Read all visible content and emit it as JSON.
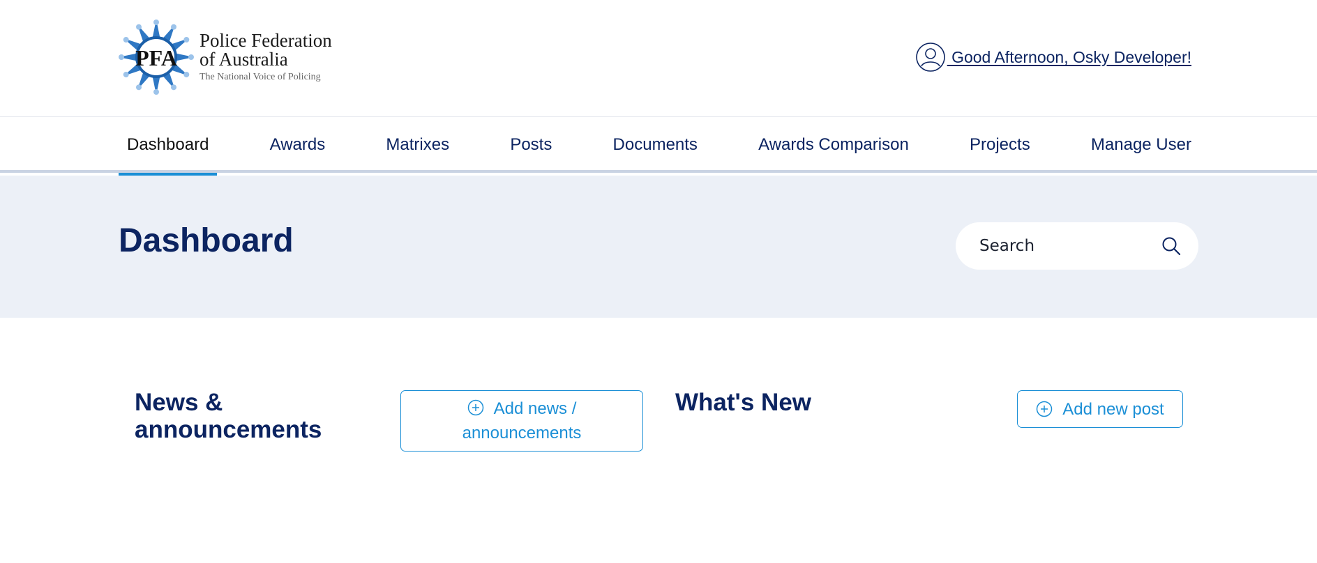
{
  "brand": {
    "name_line1": "Police Federation",
    "name_line2": "of Australia",
    "tagline": "The National Voice of Policing",
    "emblem_letters": "PFA",
    "logo_icon": "pfa-star-emblem",
    "brand_color": "#1b5fa8"
  },
  "user": {
    "icon": "user-circle-icon",
    "greeting": " Good Afternoon, Osky Developer!"
  },
  "nav": {
    "active": "Dashboard",
    "items": [
      {
        "label": "Dashboard"
      },
      {
        "label": "Awards"
      },
      {
        "label": "Matrixes"
      },
      {
        "label": "Posts"
      },
      {
        "label": "Documents"
      },
      {
        "label": "Awards Comparison"
      },
      {
        "label": "Projects"
      },
      {
        "label": "Manage User"
      }
    ]
  },
  "banner": {
    "title": "Dashboard",
    "search_placeholder": "Search",
    "search_icon": "search-icon"
  },
  "news": {
    "title_line1": "News &",
    "title_line2": "announcements",
    "button_label": "Add news / announcements",
    "button_icon": "plus-circle-icon"
  },
  "whats_new": {
    "title": "What's New",
    "button_label": "Add new post",
    "button_icon": "plus-circle-icon"
  },
  "colors": {
    "navy": "#0c2461",
    "accent": "#1b8fd6",
    "banner_bg": "#ecf0f7"
  }
}
